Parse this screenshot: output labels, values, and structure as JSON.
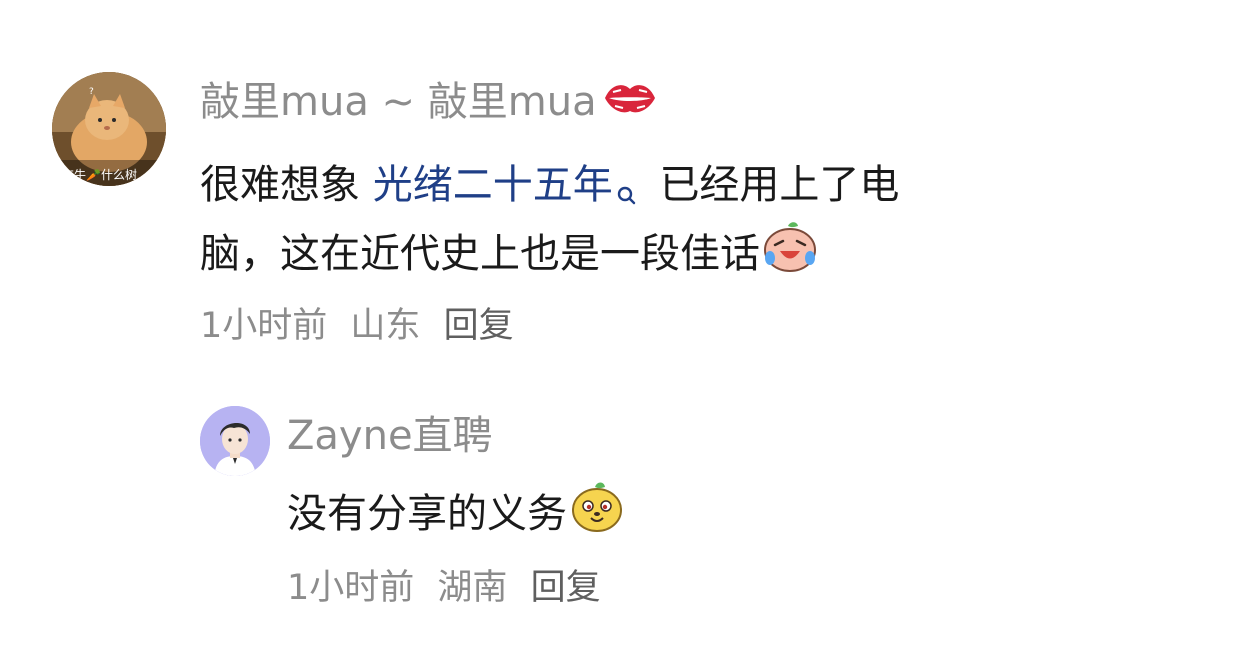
{
  "comment": {
    "username": "敲里mua ~ 敲里mua",
    "username_emoji": "kiss-lips-icon",
    "avatar_caption": "奔牛🥕什么树",
    "text_before_link": "很难想象",
    "link_text": "光绪二十五年",
    "link_icon": "search-icon",
    "text_after_link": "已经用上了电",
    "text_line2": "脑，这在近代史上也是一段佳话",
    "emoji": "laugh-cry-icon",
    "time": "1小时前",
    "location": "山东",
    "reply_label": "回复"
  },
  "reply": {
    "username": "Zayne直聘",
    "text": "没有分享的义务",
    "emoji": "dog-face-icon",
    "time": "1小时前",
    "location": "湖南",
    "reply_label": "回复"
  },
  "colors": {
    "accent_link": "#1f3f87",
    "meta": "#8c8c8c",
    "text": "#1a1a1a"
  }
}
